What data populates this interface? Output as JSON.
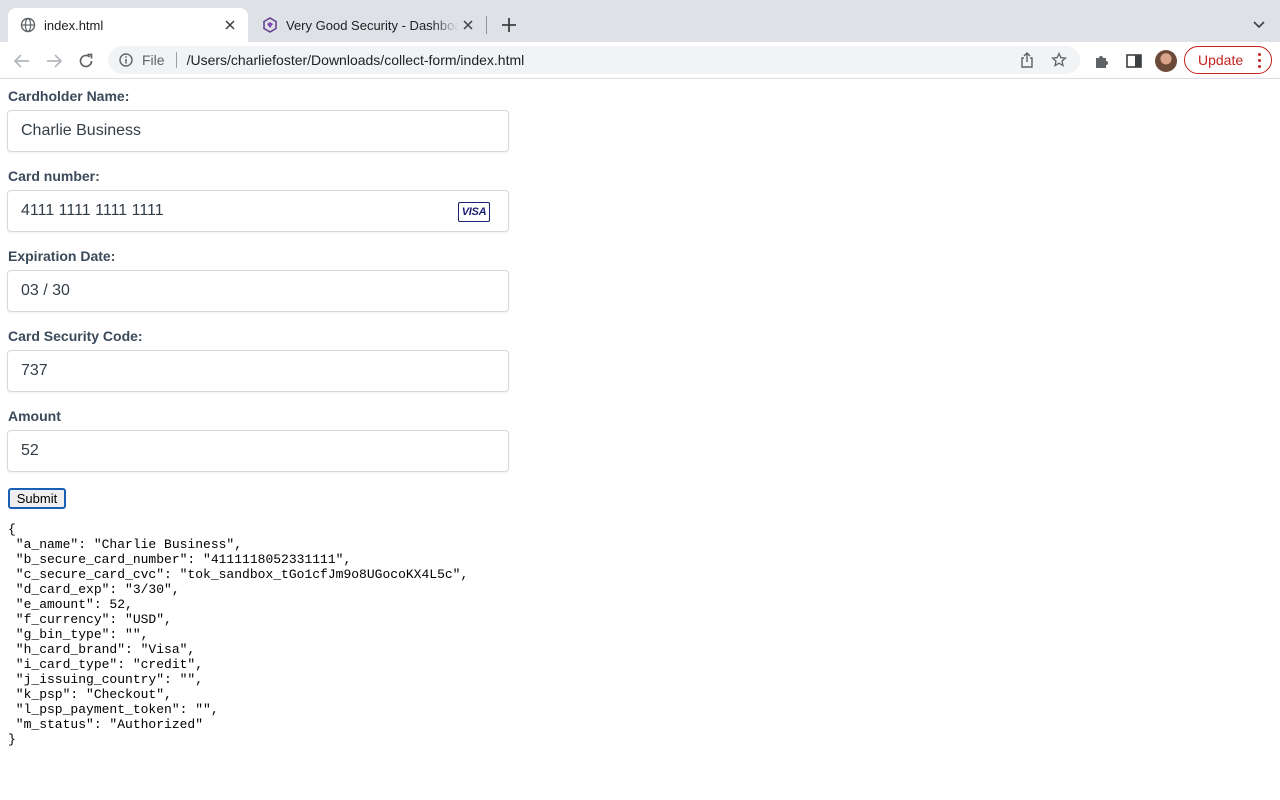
{
  "browser": {
    "tabs": [
      {
        "title": "index.html",
        "active": true,
        "icon": "globe-icon"
      },
      {
        "title": "Very Good Security - Dashboard",
        "active": false,
        "icon": "vgs-logo-icon"
      }
    ],
    "address_bar": {
      "scheme_label": "File",
      "url": "/Users/charliefoster/Downloads/collect-form/index.html"
    },
    "update_label": "Update",
    "colors": {
      "update": "#c5221f",
      "tabstrip": "#dee1e6"
    }
  },
  "form": {
    "fields": [
      {
        "label": "Cardholder Name:",
        "value": "Charlie Business"
      },
      {
        "label": "Card number:",
        "value": "4111 1111 1111 1111",
        "brand_icon": "VISA"
      },
      {
        "label": "Expiration Date:",
        "value": "03 / 30"
      },
      {
        "label": "Card Security Code:",
        "value": "737"
      },
      {
        "label": "Amount",
        "value": "52"
      }
    ],
    "submit_label": "Submit"
  },
  "response": {
    "open": "{",
    "lines": [
      " \"a_name\": \"Charlie Business\",",
      " \"b_secure_card_number\": \"4111118052331111\",",
      " \"c_secure_card_cvc\": \"tok_sandbox_tGo1cfJm9o8UGocoKX4L5c\",",
      " \"d_card_exp\": \"3/30\",",
      " \"e_amount\": 52,",
      " \"f_currency\": \"USD\",",
      " \"g_bin_type\": \"\",",
      " \"h_card_brand\": \"Visa\",",
      " \"i_card_type\": \"credit\",",
      " \"j_issuing_country\": \"\",",
      " \"k_psp\": \"Checkout\",",
      " \"l_psp_payment_token\": \"\",",
      " \"m_status\": \"Authorized\""
    ],
    "close": "}"
  }
}
